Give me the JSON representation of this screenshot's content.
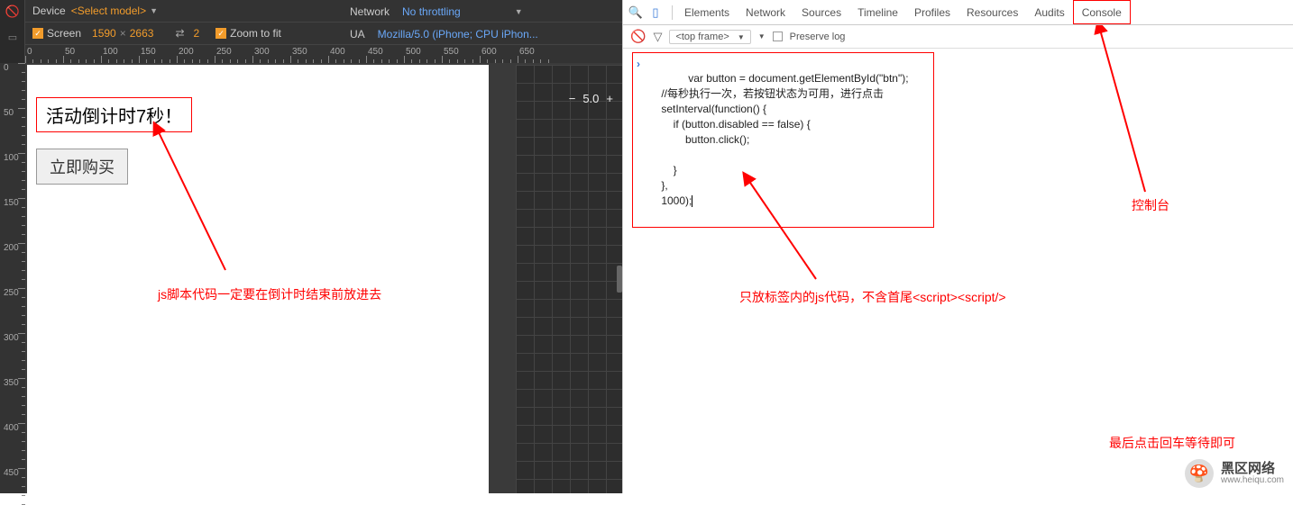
{
  "toolbar": {
    "device_label": "Device",
    "device_value": "<Select model>",
    "screen_label": "Screen",
    "screen_w": "1590",
    "screen_sep": "×",
    "screen_h": "2663",
    "dpr_value": "2",
    "zoom_label": "Zoom to fit",
    "network_label": "Network",
    "network_value": "No throttling",
    "ua_label": "UA",
    "ua_value": "Mozilla/5.0 (iPhone; CPU iPhon..."
  },
  "ruler_h": [
    "0",
    "50",
    "100",
    "150",
    "200",
    "250",
    "300",
    "350",
    "400",
    "450",
    "500",
    "550",
    "600",
    "650"
  ],
  "ruler_v": [
    "0",
    "50",
    "100",
    "150",
    "200",
    "250",
    "300",
    "350",
    "400",
    "450"
  ],
  "zoom": {
    "minus": "−",
    "value": "5.0",
    "plus": "+"
  },
  "page": {
    "countdown": "活动倒计时7秒！",
    "buy": "立即购买"
  },
  "annotations": {
    "left_note": "js脚本代码一定要在倒计时结束前放进去",
    "mid_note": "只放标签内的js代码，不含首尾<script><script/>",
    "right_note": "控制台",
    "bottom_note": "最后点击回车等待即可"
  },
  "devtools": {
    "tabs": [
      "Elements",
      "Network",
      "Sources",
      "Timeline",
      "Profiles",
      "Resources",
      "Audits",
      "Console"
    ],
    "frame": "<top frame>",
    "preserve": "Preserve log"
  },
  "code": "var button = document.getElementById(\"btn\");\n    //每秒执行一次，若按钮状态为可用，进行点击\n    setInterval(function() {\n        if (button.disabled == false) {\n            button.click();\n\n        }\n    },\n    1000);",
  "watermark": {
    "name": "黑区网络",
    "url": "www.heiqu.com"
  }
}
